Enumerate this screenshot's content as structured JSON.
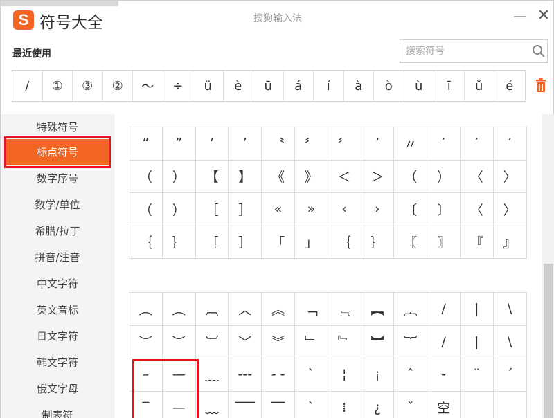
{
  "window": {
    "title": "符号大全",
    "logo_text": "S",
    "ime_name": "搜狗输入法",
    "minimize_label": "—",
    "close_label": "✕"
  },
  "recent": {
    "label": "最近使用",
    "symbols": [
      "/",
      "①",
      "③",
      "②",
      "～",
      "÷",
      "ü",
      "è",
      "ū",
      "á",
      "í",
      "à",
      "ò",
      "ù",
      "ī",
      "ǔ",
      "é"
    ]
  },
  "search": {
    "placeholder": "搜索符号"
  },
  "sidebar": {
    "items": [
      "特殊符号",
      "标点符号",
      "数字序号",
      "数学/单位",
      "希腊/拉丁",
      "拼音/注音",
      "中文字符",
      "英文音标",
      "日文字符",
      "韩文字符",
      "俄文字母",
      "制表符"
    ],
    "active_index": 1
  },
  "punctuation_grid": [
    [
      "“",
      "”",
      "‘",
      "’",
      "〝",
      "〞",
      "〞",
      "’",
      "〃",
      "′",
      "′",
      "′"
    ],
    [
      "（",
      "）",
      "【",
      "】",
      "《",
      "》",
      "＜",
      "＞",
      "（",
      "）",
      "〈",
      "〉"
    ],
    [
      "（",
      "）",
      "［",
      "］",
      "«",
      "»",
      "‹",
      "›",
      "〔",
      "〕",
      "〈",
      "〉"
    ],
    [
      "｛",
      "｝",
      "［",
      "］",
      "「",
      "」",
      "｛",
      "｝",
      "〖",
      "〗",
      "『",
      "』"
    ]
  ],
  "vertical_grid": [
    [
      "︵",
      "︵",
      "︹",
      "︿",
      "︽",
      "﹁",
      "﹃",
      "︻",
      "︷",
      "/",
      "|",
      "\\"
    ],
    [
      "︶",
      "︶",
      "︺",
      "﹀",
      "︾",
      "﹂",
      "﹄",
      "︼",
      "︸",
      "/",
      "|",
      "\\"
    ],
    [
      "–",
      "—",
      "﹏",
      "---",
      "- -",
      "`",
      "¦",
      "¡",
      "ˆ",
      "-",
      "¨",
      "ˊ"
    ],
    [
      "‾",
      "—",
      "﹏",
      "‾‾‾",
      "‾‾",
      "ˋ",
      "⁞",
      "¿",
      "ˇ",
      "空",
      "",
      ""
    ]
  ],
  "colors": {
    "accent": "#f26522",
    "highlight_frame": "#e8141d",
    "trash": "#f26522"
  }
}
